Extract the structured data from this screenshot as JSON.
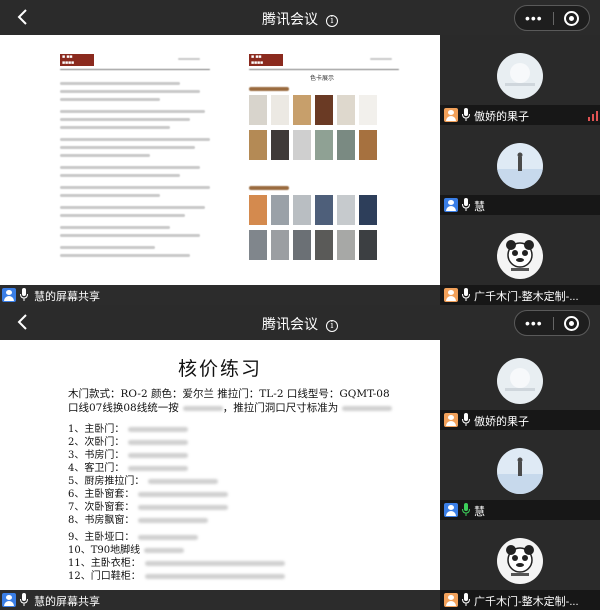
{
  "top": {
    "app_title": "腾讯会议",
    "share_label": "慧的屏幕共享",
    "participants": [
      {
        "name": "傲娇的果子",
        "muted": false,
        "mic_active": true,
        "icon_color": "#f2a15a"
      },
      {
        "name": "慧",
        "muted": false,
        "mic_active": false,
        "icon_color": "#3a7ee6"
      },
      {
        "name": "广千木门-整木定制-...",
        "muted": false,
        "mic_active": false,
        "icon_color": "#f2a15a"
      }
    ],
    "doc_heading_right": "色卡展示"
  },
  "bottom": {
    "app_title": "腾讯会议",
    "share_label": "慧的屏幕共享",
    "participants": [
      {
        "name": "傲娇的果子",
        "icon_color": "#f2a15a"
      },
      {
        "name": "慧",
        "icon_color": "#3a7ee6"
      },
      {
        "name": "广千木门-整木定制-...",
        "icon_color": "#f2a15a"
      }
    ],
    "doc": {
      "title": "核价练习",
      "spec_line1": "木门款式：RO-2    颜色：爱尔兰    推拉门：TL-2  口线型号：GQMT-08",
      "spec_line2": "口线07线换08线统一按",
      "spec_line2_tail": "，推拉门洞口尺寸标准为",
      "items": [
        "1、主卧门：",
        "2、次卧门：",
        "3、书房门：",
        "4、客卫门：",
        "5、厨房推拉门：",
        "6、主卧窗套：",
        "7、次卧窗套：",
        "8、书房飘窗：",
        "9、主卧垭口：",
        "10、T90地脚线",
        "11、主卧衣柜：",
        "12、门口鞋柜："
      ]
    }
  },
  "colors": {
    "mic_green": "#3ccf5a",
    "signal_red": "#e05353",
    "user_blue": "#3a7ee6",
    "user_orange": "#f2a15a"
  }
}
